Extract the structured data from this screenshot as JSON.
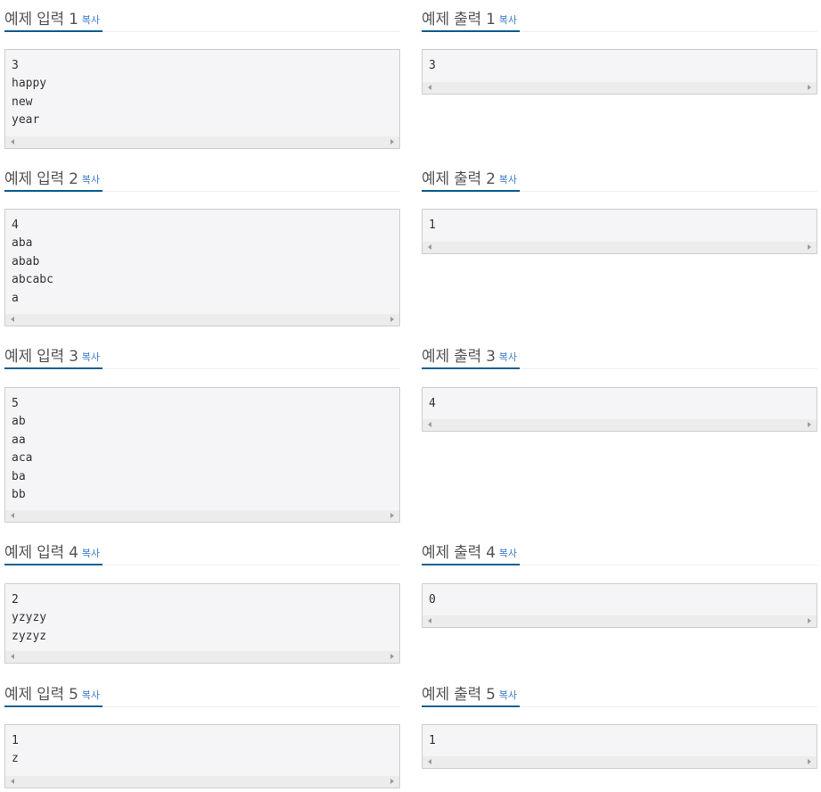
{
  "copy_label": "복사",
  "rows": [
    {
      "input_title": "예제 입력 1",
      "output_title": "예제 출력 1",
      "input_text": "3\nhappy\nnew\nyear",
      "output_text": "3"
    },
    {
      "input_title": "예제 입력 2",
      "output_title": "예제 출력 2",
      "input_text": "4\naba\nabab\nabcabc\na",
      "output_text": "1"
    },
    {
      "input_title": "예제 입력 3",
      "output_title": "예제 출력 3",
      "input_text": "5\nab\naa\naca\nba\nbb",
      "output_text": "4"
    },
    {
      "input_title": "예제 입력 4",
      "output_title": "예제 출력 4",
      "input_text": "2\nyzyzy\nzyzyz",
      "output_text": "0"
    },
    {
      "input_title": "예제 입력 5",
      "output_title": "예제 출력 5",
      "input_text": "1\nz",
      "output_text": "1"
    }
  ]
}
